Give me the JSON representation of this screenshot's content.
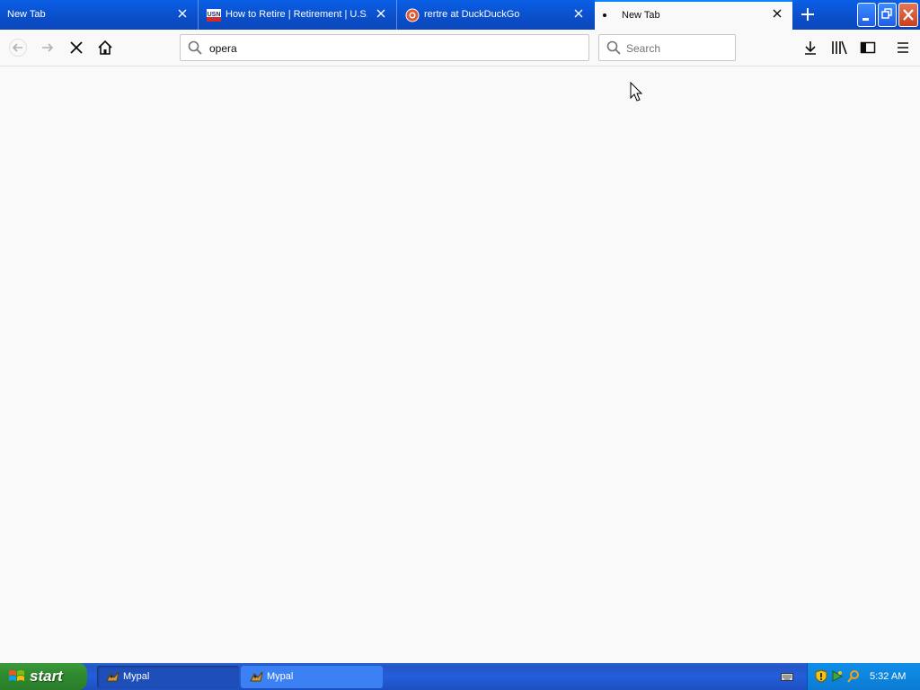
{
  "tabs": [
    {
      "title": "New Tab",
      "active": false,
      "favicon": ""
    },
    {
      "title": "How to Retire | Retirement | U.S.",
      "active": false,
      "favicon": "usn-icon"
    },
    {
      "title": "rertre at DuckDuckGo",
      "active": false,
      "favicon": "duckduckgo-icon"
    },
    {
      "title": "New Tab",
      "active": true,
      "favicon": "dot-icon"
    }
  ],
  "navbar": {
    "url": "opera",
    "search_placeholder": "Search"
  },
  "taskbar": {
    "start_label": "start",
    "tasks": [
      {
        "label": "Mypal",
        "active": true
      },
      {
        "label": "Mypal",
        "active": false
      }
    ],
    "clock": "5:32 AM"
  },
  "colors": {
    "tabstrip": "#0a4ec9",
    "active_tab": "#f9f9fa",
    "accent": "#0a84ff",
    "start_green": "#2f8a2f",
    "taskbar_blue": "#245edb",
    "tray_blue": "#0f8fe8"
  }
}
